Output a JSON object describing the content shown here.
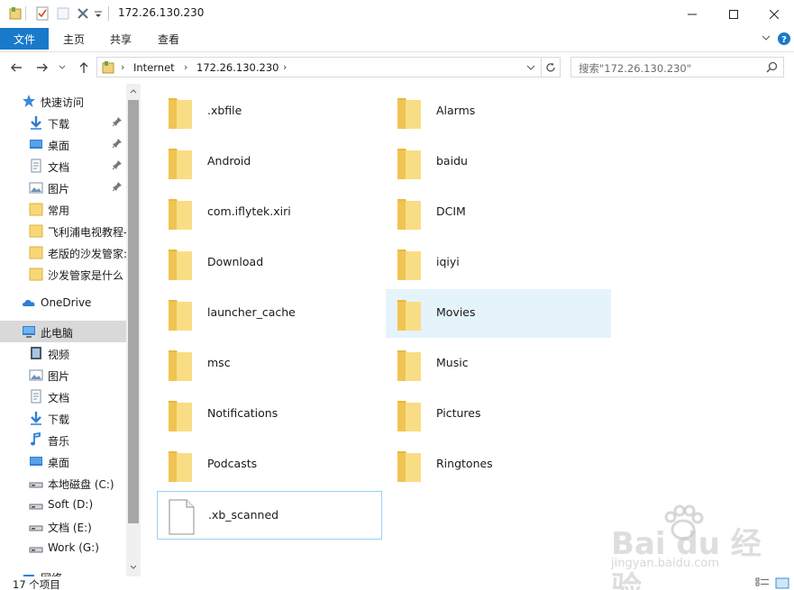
{
  "window": {
    "title": "172.26.130.230"
  },
  "ribbon": {
    "file_tab": "文件",
    "tabs": [
      "主页",
      "共享",
      "查看"
    ]
  },
  "address": {
    "breadcrumbs": [
      "Internet",
      "172.26.130.230"
    ],
    "search_placeholder": "搜索\"172.26.130.230\""
  },
  "nav": {
    "items": [
      {
        "label": "快速访问",
        "icon": "star-icon",
        "pinned": false,
        "selected": false
      },
      {
        "label": "下载",
        "icon": "download-icon",
        "pinned": true,
        "selected": false
      },
      {
        "label": "桌面",
        "icon": "desktop-icon",
        "pinned": true,
        "selected": false
      },
      {
        "label": "文档",
        "icon": "document-icon",
        "pinned": true,
        "selected": false
      },
      {
        "label": "图片",
        "icon": "picture-icon",
        "pinned": true,
        "selected": false
      },
      {
        "label": "常用",
        "icon": "folder-icon",
        "pinned": false,
        "selected": false
      },
      {
        "label": "飞利浦电视教程-",
        "icon": "folder-icon",
        "pinned": false,
        "selected": false
      },
      {
        "label": "老版的沙发管家:",
        "icon": "folder-icon",
        "pinned": false,
        "selected": false
      },
      {
        "label": "沙发管家是什么",
        "icon": "folder-icon",
        "pinned": false,
        "selected": false
      },
      {
        "label": "OneDrive",
        "icon": "cloud-icon",
        "pinned": false,
        "selected": false
      },
      {
        "label": "此电脑",
        "icon": "computer-icon",
        "pinned": false,
        "selected": true
      },
      {
        "label": "视频",
        "icon": "video-icon",
        "pinned": false,
        "selected": false
      },
      {
        "label": "图片",
        "icon": "picture-icon",
        "pinned": false,
        "selected": false
      },
      {
        "label": "文档",
        "icon": "document-icon",
        "pinned": false,
        "selected": false
      },
      {
        "label": "下载",
        "icon": "download-icon",
        "pinned": false,
        "selected": false
      },
      {
        "label": "音乐",
        "icon": "music-icon",
        "pinned": false,
        "selected": false
      },
      {
        "label": "桌面",
        "icon": "desktop-icon",
        "pinned": false,
        "selected": false
      },
      {
        "label": "本地磁盘 (C:)",
        "icon": "drive-icon",
        "pinned": false,
        "selected": false
      },
      {
        "label": "Soft (D:)",
        "icon": "drive-icon",
        "pinned": false,
        "selected": false
      },
      {
        "label": "文档 (E:)",
        "icon": "drive-icon",
        "pinned": false,
        "selected": false
      },
      {
        "label": "Work (G:)",
        "icon": "drive-icon",
        "pinned": false,
        "selected": false
      },
      {
        "label": "网络",
        "icon": "network-icon",
        "pinned": false,
        "selected": false
      }
    ]
  },
  "files": [
    {
      "name": ".xbfile",
      "type": "folder"
    },
    {
      "name": "Alarms",
      "type": "folder"
    },
    {
      "name": "Android",
      "type": "folder"
    },
    {
      "name": "baidu",
      "type": "folder"
    },
    {
      "name": "com.iflytek.xiri",
      "type": "folder"
    },
    {
      "name": "DCIM",
      "type": "folder"
    },
    {
      "name": "Download",
      "type": "folder"
    },
    {
      "name": "iqiyi",
      "type": "folder"
    },
    {
      "name": "launcher_cache",
      "type": "folder"
    },
    {
      "name": "Movies",
      "type": "folder",
      "hover": true
    },
    {
      "name": "msc",
      "type": "folder"
    },
    {
      "name": "Music",
      "type": "folder"
    },
    {
      "name": "Notifications",
      "type": "folder"
    },
    {
      "name": "Pictures",
      "type": "folder"
    },
    {
      "name": "Podcasts",
      "type": "folder"
    },
    {
      "name": "Ringtones",
      "type": "folder"
    },
    {
      "name": ".xb_scanned",
      "type": "file",
      "focus": true
    }
  ],
  "status": {
    "item_count": "17 个项目"
  },
  "watermark": {
    "logo": "Bai du 经验",
    "url": "jingyan.baidu.com"
  },
  "colors": {
    "accent": "#1979ca",
    "folder": "#f8d775",
    "hover": "#e5f3fb",
    "selected_nav": "#d9d9d9"
  }
}
